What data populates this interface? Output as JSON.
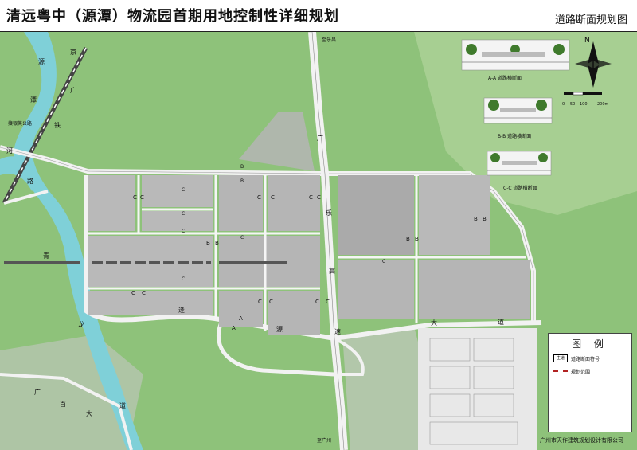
{
  "title": "清远粤中（源潭）物流园首期用地控制性详细规划",
  "subtitle": "道路断面规划图",
  "north": "N",
  "scale": {
    "ticks": [
      "0",
      "50",
      "100",
      "200m"
    ]
  },
  "map_labels": {
    "to_lechang": "至乐昌",
    "to_guangzhou": "至广州",
    "jie_yin_road": "接银英公路",
    "river_chars": [
      "源",
      "潭",
      "河"
    ],
    "rail_chars": [
      "京",
      "广",
      "铁",
      "路"
    ],
    "river_west_chars": [
      "河",
      "路"
    ],
    "qinglong_chars": [
      "青",
      "龙"
    ],
    "highway_chars": [
      "广",
      "乐",
      "高",
      "速"
    ],
    "yuantan_road_chars": [
      "逢",
      "源",
      "大",
      "道"
    ],
    "guangbai_chars": [
      "广",
      "百",
      "大",
      "道"
    ],
    "section_marks": [
      "A",
      "A",
      "B",
      "B",
      "C",
      "C",
      "C",
      "C",
      "C",
      "C",
      "C",
      "C",
      "C",
      "C",
      "C",
      "C",
      "C",
      "C",
      "C",
      "C",
      "C",
      "C",
      "B",
      "B",
      "B",
      "B",
      "B",
      "B"
    ]
  },
  "sections": {
    "aa": "A-A 道路横断面",
    "bb": "B-B 道路横断面",
    "cc": "C-C 道路横断面"
  },
  "legend": {
    "title": "图 例",
    "items": [
      {
        "symbol": "主道",
        "label": "道路断面符号"
      },
      {
        "symbol": "",
        "label": "规划范围"
      }
    ]
  },
  "company": "广州市天作建筑规划设计有限公司",
  "colors": {
    "forest": "#8ec27a",
    "forest_light": "#b8d8a6",
    "river": "#7fd0d8",
    "road": "#f2f2f2",
    "plot_gray": "#b9b9b9",
    "rail_dark": "#4d4d4d"
  }
}
